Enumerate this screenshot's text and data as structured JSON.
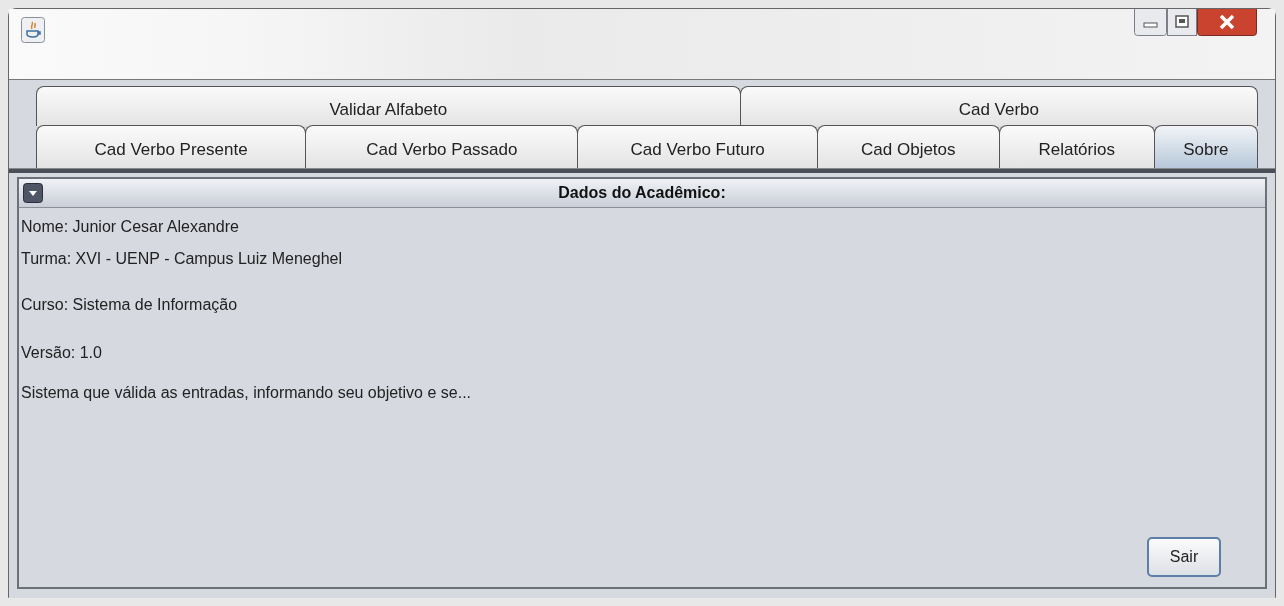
{
  "tab_rows": [
    [
      {
        "label": "Validar Alfabeto",
        "selected": false
      },
      {
        "label": "Cad Verbo",
        "selected": false
      }
    ],
    [
      {
        "label": "Cad Verbo Presente",
        "selected": false
      },
      {
        "label": "Cad Verbo Passado",
        "selected": false
      },
      {
        "label": "Cad Verbo Futuro",
        "selected": false
      },
      {
        "label": "Cad Objetos",
        "selected": false
      },
      {
        "label": "Relatórios",
        "selected": false
      },
      {
        "label": "Sobre",
        "selected": true
      }
    ]
  ],
  "panel": {
    "title": "Dados do Acadêmico:",
    "lines": [
      "Nome: Junior Cesar Alexandre",
      "Turma: XVI - UENP - Campus Luiz Meneghel",
      "Curso: Sistema de Informação",
      "Versão: 1.0",
      "Sistema que válida as entradas, informando seu objetivo e se..."
    ],
    "buttons": [
      "Sair"
    ]
  }
}
